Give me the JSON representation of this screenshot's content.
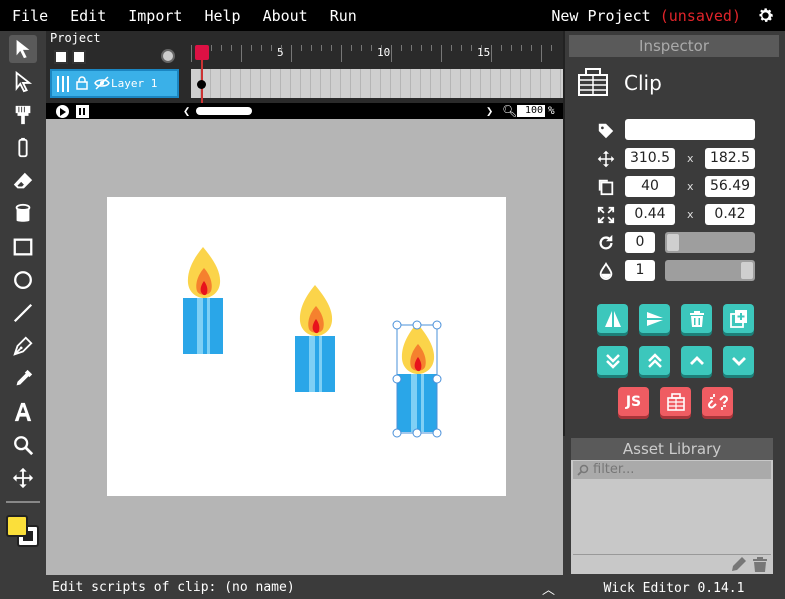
{
  "menu": {
    "items": [
      "File",
      "Edit",
      "Import",
      "Help",
      "About",
      "Run"
    ]
  },
  "project": {
    "name": "New Project",
    "status": "(unsaved)"
  },
  "timeline": {
    "label": "Project",
    "ruler_labels": [
      "5",
      "10",
      "15"
    ],
    "layer_name": "Layer 1",
    "zoom_value": "100",
    "zoom_unit": "%"
  },
  "inspector": {
    "header": "Inspector",
    "title": "Clip",
    "name_value": "",
    "x": "310.5",
    "y": "182.5",
    "width": "40",
    "height": "56.49",
    "scale_x": "0.44",
    "scale_y": "0.42",
    "rotation": "0",
    "opacity": "1",
    "separator": "x",
    "rotation_slider": 0.0,
    "opacity_slider": 1.0,
    "js_label": "JS"
  },
  "asset_library": {
    "header": "Asset Library",
    "filter_placeholder": "filter..."
  },
  "scriptbar": {
    "text": "Edit scripts of clip:",
    "target": "(no name)"
  },
  "footer": {
    "version": "Wick Editor 0.14.1"
  },
  "colors": {
    "accent_teal": "#3cc7bc",
    "accent_red": "#ef5c62",
    "layer_blue": "#3ab0e8",
    "fill_color": "#fbdf3a",
    "unsaved_red": "#e0242a"
  }
}
